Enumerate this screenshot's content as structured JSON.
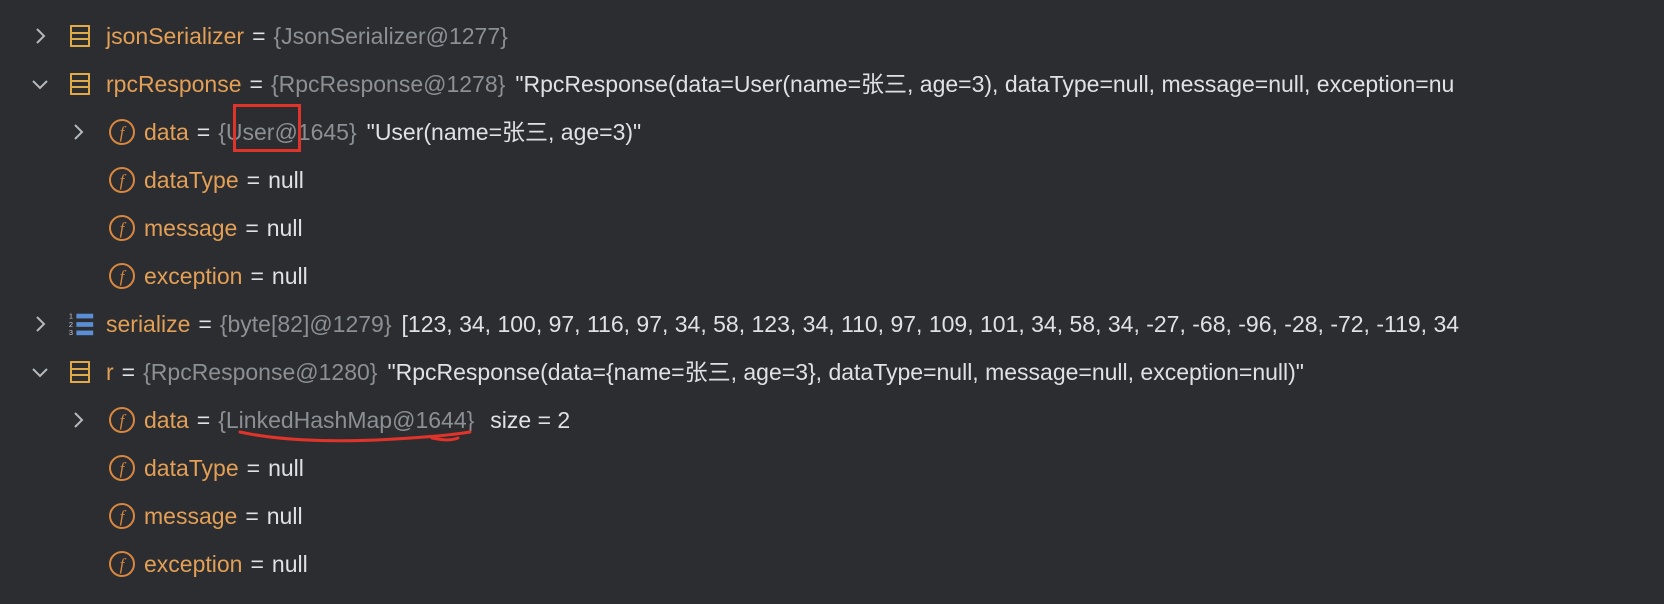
{
  "variables": [
    {
      "name": "jsonSerializer",
      "type": "{JsonSerializer@1277}",
      "value": "",
      "kind": "object",
      "expander": "collapsed"
    },
    {
      "name": "rpcResponse",
      "type": "{RpcResponse@1278}",
      "value": "\"RpcResponse(data=User(name=张三, age=3), dataType=null, message=null, exception=nu",
      "kind": "object",
      "expander": "expanded",
      "children": [
        {
          "name": "data",
          "type_prefix": "{",
          "type_name": "User",
          "type_suffix": "@1645}",
          "value": "\"User(name=张三, age=3)\"",
          "expander": "collapsed"
        },
        {
          "name": "dataType",
          "eq_value": "null"
        },
        {
          "name": "message",
          "eq_value": "null"
        },
        {
          "name": "exception",
          "eq_value": "null"
        }
      ]
    },
    {
      "name": "serialize",
      "type": "{byte[82]@1279}",
      "value": "[123, 34, 100, 97, 116, 97, 34, 58, 123, 34, 110, 97, 109, 101, 34, 58, 34, -27, -68, -96, -28, -72, -119, 34",
      "kind": "array",
      "expander": "collapsed"
    },
    {
      "name": "r",
      "type": "{RpcResponse@1280}",
      "value": "\"RpcResponse(data={name=张三, age=3}, dataType=null, message=null, exception=null)\"",
      "kind": "object",
      "expander": "expanded",
      "children": [
        {
          "name": "data",
          "type": "{LinkedHashMap@1644}",
          "value": "size = 2",
          "expander": "collapsed"
        },
        {
          "name": "dataType",
          "eq_value": "null"
        },
        {
          "name": "message",
          "eq_value": "null"
        },
        {
          "name": "exception",
          "eq_value": "null"
        }
      ]
    }
  ],
  "equals_sign": "=",
  "field_icon_letter": "f",
  "array_icon_digits": [
    "1",
    "2",
    "3"
  ],
  "colors": {
    "background": "#2b2d30",
    "variable_name": "#e39f55",
    "type_text": "#8c8f94",
    "value_text": "#dfe1e5",
    "annotation_red": "#e0332a"
  },
  "icons": {
    "expand": "chevron-right-icon",
    "collapse": "chevron-down-icon",
    "object": "object-variable-icon",
    "array": "array-variable-icon",
    "field": "field-icon"
  }
}
